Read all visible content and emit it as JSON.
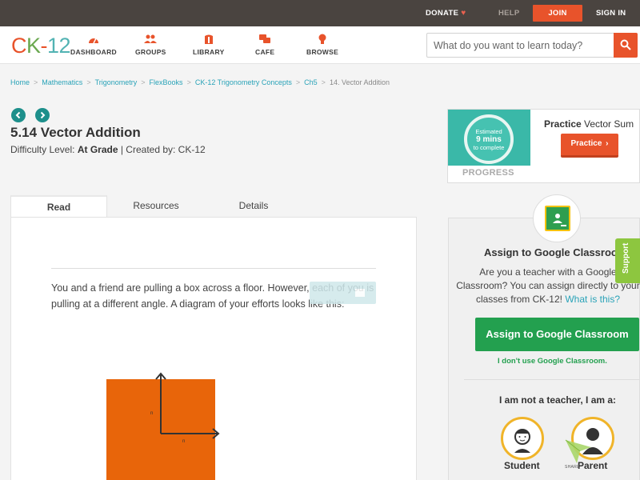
{
  "topbar": {
    "donate": "DONATE",
    "help": "HELP",
    "join": "JOIN",
    "sign_in": "SIGN IN"
  },
  "logo": {
    "c": "C",
    "k": "K",
    "dash": "-",
    "num": "12"
  },
  "nav": {
    "dashboard": "DASHBOARD",
    "groups": "GROUPS",
    "library": "LIBRARY",
    "cafe": "CAFE",
    "browse": "BROWSE"
  },
  "search": {
    "placeholder": "What do you want to learn today?"
  },
  "breadcrumb": {
    "items": [
      "Home",
      "Mathematics",
      "Trigonometry",
      "FlexBooks",
      "CK-12 Trigonometry Concepts",
      "Ch5"
    ],
    "current": "14. Vector Addition"
  },
  "page": {
    "title": "5.14 Vector Addition",
    "difficulty_label": "Difficulty Level:",
    "difficulty_value": "At Grade",
    "created_by": "| Created by: CK-12"
  },
  "practice": {
    "estimated": "Estimated",
    "mins": "9 mins",
    "to_complete": "to complete",
    "progress": "PROGRESS",
    "label_bold": "Practice",
    "label_rest": " Vector Sum",
    "button": "Practice"
  },
  "tabs": {
    "read": "Read",
    "resources": "Resources",
    "details": "Details"
  },
  "content": {
    "paragraph": "You and a friend are pulling a box across a floor. However, each of you is pulling at a different angle. A diagram of your efforts looks like this:",
    "diagram_label_vertical": "n",
    "diagram_label_horizontal": "n"
  },
  "classroom": {
    "title": "Assign to Google Classroom",
    "text_1": "Are you a teacher with a Google Classroom? You can assign directly to your classes from CK-12!",
    "link": "What is this?",
    "button": "Assign to Google Classroom",
    "no_use": "I don't use Google Classroom.",
    "not_teacher": "I am not a teacher, I am a:",
    "student": "Student",
    "parent": "Parent",
    "share": "SHARE"
  },
  "support": "Support",
  "colors": {
    "accent": "#e8532b",
    "teal": "#1d8f8b",
    "link": "#2aa3b8",
    "green": "#23a04f",
    "support": "#8dc63f"
  }
}
